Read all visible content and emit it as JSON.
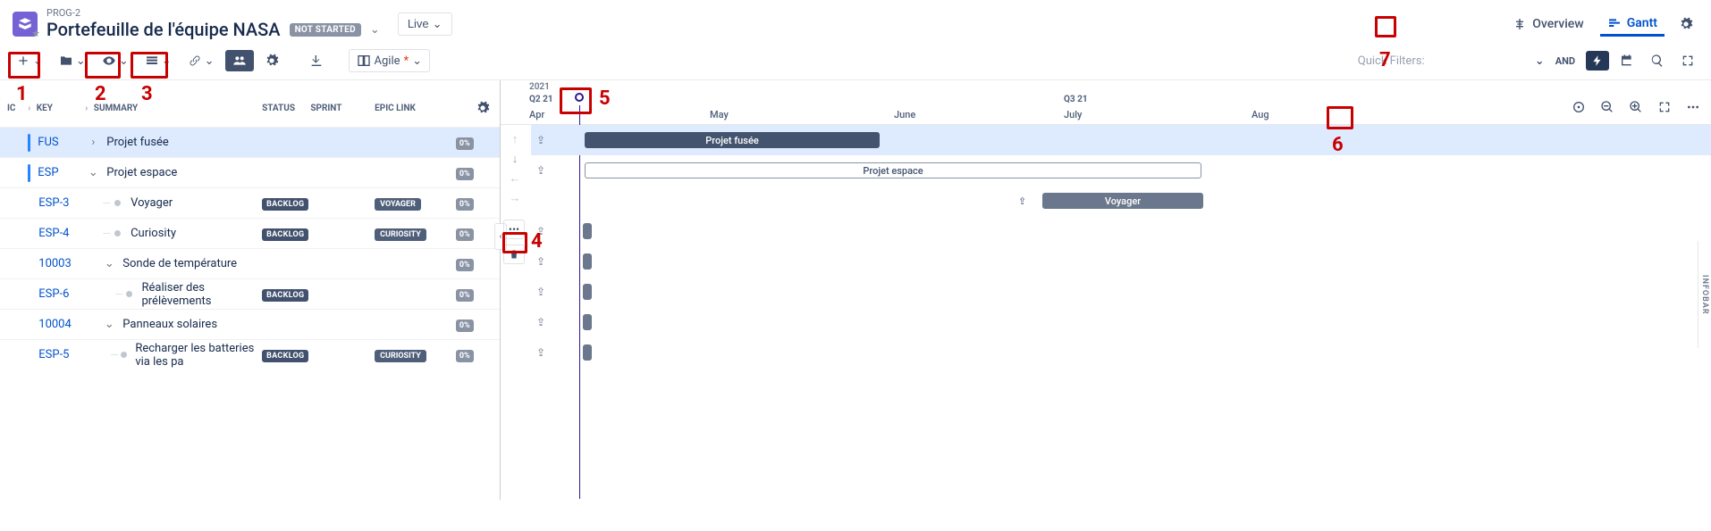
{
  "header": {
    "breadcrumb": "PROG-2",
    "title": "Portefeuille de l'équipe NASA",
    "status_pill": "NOT STARTED",
    "live_label": "Live",
    "overview_label": "Overview",
    "gantt_label": "Gantt"
  },
  "toolbar": {
    "agile_label": "Agile",
    "quick_filters_placeholder": "Quick Filters:",
    "and_label": "AND"
  },
  "columns": {
    "icon": "IC",
    "key": "KEY",
    "summary": "SUMMARY",
    "status": "STATUS",
    "sprint": "SPRINT",
    "epic": "EPIC LINK"
  },
  "rows": [
    {
      "key": "FUS",
      "summary": "Projet fusée",
      "status": "",
      "sprint": "",
      "epic": "",
      "pct": "0%",
      "depth": 0,
      "exp": "›",
      "hl": true
    },
    {
      "key": "ESP",
      "summary": "Projet espace",
      "status": "",
      "sprint": "",
      "epic": "",
      "pct": "0%",
      "depth": 0,
      "exp": "v",
      "hl": false
    },
    {
      "key": "ESP-3",
      "summary": "Voyager",
      "status": "BACKLOG",
      "sprint": "",
      "epic": "VOYAGER",
      "pct": "0%",
      "depth": 1,
      "exp": "•",
      "hl": false
    },
    {
      "key": "ESP-4",
      "summary": "Curiosity",
      "status": "BACKLOG",
      "sprint": "",
      "epic": "CURIOSITY",
      "pct": "0%",
      "depth": 1,
      "exp": "•",
      "hl": false
    },
    {
      "key": "10003",
      "summary": "Sonde de température",
      "status": "",
      "sprint": "",
      "epic": "",
      "pct": "0%",
      "depth": 1,
      "exp": "v",
      "hl": false
    },
    {
      "key": "ESP-6",
      "summary": "Réaliser des prélèvements",
      "status": "BACKLOG",
      "sprint": "",
      "epic": "",
      "pct": "0%",
      "depth": 2,
      "exp": "•",
      "hl": false
    },
    {
      "key": "10004",
      "summary": "Panneaux solaires",
      "status": "",
      "sprint": "",
      "epic": "",
      "pct": "0%",
      "depth": 1,
      "exp": "v",
      "hl": false
    },
    {
      "key": "ESP-5",
      "summary": "Recharger les batteries via les pa",
      "status": "BACKLOG",
      "sprint": "",
      "epic": "CURIOSITY",
      "pct": "0%",
      "depth": 2,
      "exp": "•",
      "hl": false
    }
  ],
  "gantt": {
    "year": "2021",
    "q2_label": "Q2 21",
    "q3_label": "Q3 21",
    "months": {
      "apr": "Apr",
      "may": "May",
      "jun": "June",
      "jul": "July",
      "aug": "Aug"
    },
    "bars": {
      "fusee_label": "Projet fusée",
      "espace_label": "Projet espace",
      "voyager_label": "Voyager"
    }
  },
  "infobar_label": "INFOBAR",
  "annotations": {
    "n1": "1",
    "n2": "2",
    "n3": "3",
    "n4": "4",
    "n5": "5",
    "n6": "6",
    "n7": "7"
  }
}
